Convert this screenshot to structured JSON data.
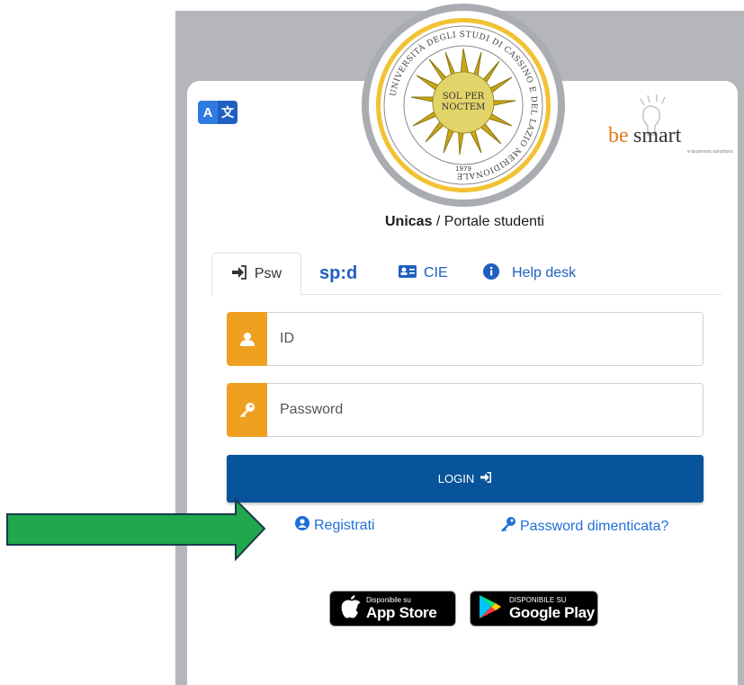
{
  "lang_toggle": {
    "left": "A",
    "right": "文"
  },
  "logo": {
    "ring_text": "UNIVERSITÀ DEGLI STUDI DI CASSINO E DEL LAZIO MERIDIONALE",
    "motto_line1": "SOL PER",
    "motto_line2": "NOCTEM",
    "year": "1979"
  },
  "brand": {
    "name_be": "be",
    "name_smart": "smart",
    "tagline": "e-business solutions"
  },
  "title": {
    "bold": "Unicas",
    "rest": " / Portale studenti"
  },
  "tabs": [
    {
      "label": "Psw",
      "icon": "sign-in-icon"
    },
    {
      "label": "sp:d",
      "icon": "spid-logo"
    },
    {
      "label": "CIE",
      "icon": "id-card-icon"
    },
    {
      "label": "Help desk",
      "icon": "info-icon"
    }
  ],
  "form": {
    "id_placeholder": "ID",
    "password_placeholder": "Password",
    "login_label": "LOGIN"
  },
  "links": {
    "register": "Registrati",
    "forgot": "Password dimenticata?"
  },
  "stores": {
    "apple": {
      "small": "Disponibile su",
      "big": "App Store"
    },
    "google": {
      "small": "DISPONIBILE SU",
      "big": "Google Play"
    }
  },
  "colors": {
    "accent": "#f0a020",
    "primary": "#07549a",
    "link": "#1f6fd8",
    "arrow": "#1fa84c"
  }
}
